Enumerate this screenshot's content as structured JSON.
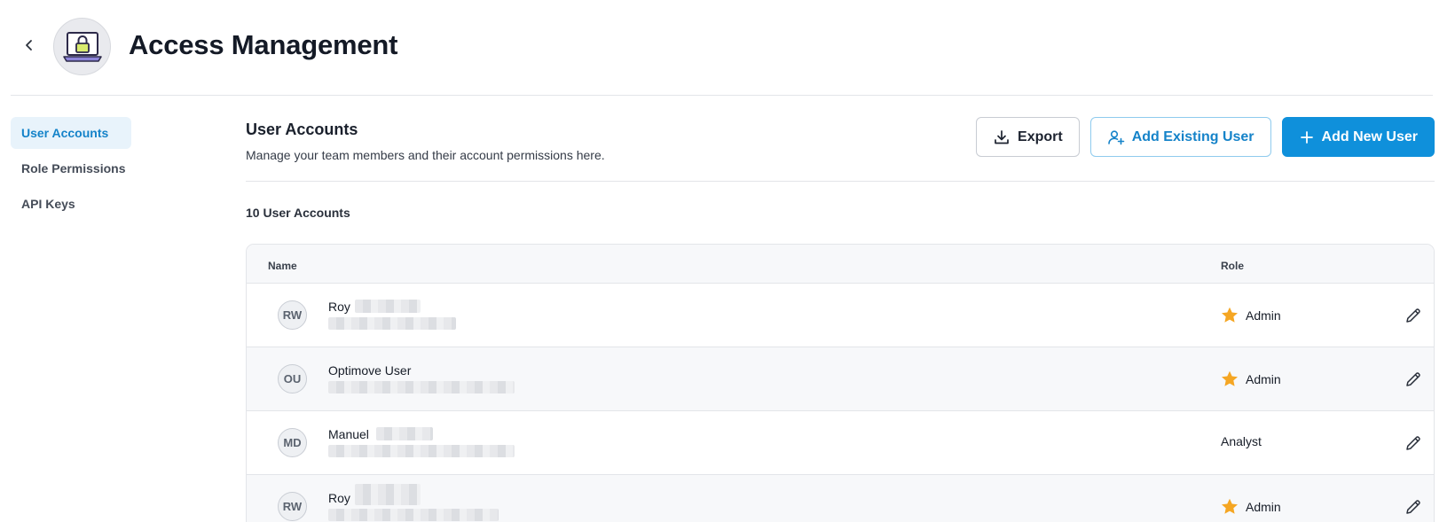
{
  "header": {
    "title": "Access Management"
  },
  "sidebar": {
    "items": [
      {
        "label": "User Accounts",
        "active": true
      },
      {
        "label": "Role Permissions",
        "active": false
      },
      {
        "label": "API Keys",
        "active": false
      }
    ]
  },
  "main": {
    "title": "User Accounts",
    "description": "Manage your team members and their account permissions here.",
    "buttons": {
      "export": "Export",
      "add_existing": "Add Existing User",
      "add_new": "Add New User"
    },
    "count_label": "10 User Accounts",
    "table": {
      "columns": {
        "name": "Name",
        "role": "Role"
      },
      "rows": [
        {
          "initials": "RW",
          "name": "Roy",
          "role": "Admin",
          "role_icon": "star-icon"
        },
        {
          "initials": "OU",
          "name": "Optimove User",
          "role": "Admin",
          "role_icon": "star-icon"
        },
        {
          "initials": "MD",
          "name": "Manuel",
          "role": "Analyst",
          "role_icon": ""
        },
        {
          "initials": "RW",
          "name": "Roy",
          "role": "Admin",
          "role_icon": "star-icon"
        }
      ]
    }
  },
  "colors": {
    "accent": "#0f90db",
    "accent_text": "#1583c9",
    "nav_active_bg": "#e8f3fb",
    "star": "#f5a623"
  }
}
